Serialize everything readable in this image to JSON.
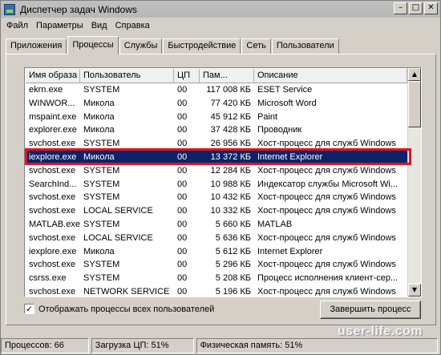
{
  "window": {
    "title": "Диспетчер задач Windows"
  },
  "menu": [
    "Файл",
    "Параметры",
    "Вид",
    "Справка"
  ],
  "tabs": [
    "Приложения",
    "Процессы",
    "Службы",
    "Быстродействие",
    "Сеть",
    "Пользователи"
  ],
  "active_tab": "Процессы",
  "columns": [
    "Имя образа",
    "Пользователь",
    "ЦП",
    "Пам...",
    "Описание"
  ],
  "processes": [
    [
      "ekrn.exe",
      "SYSTEM",
      "00",
      "117 008 КБ",
      "ESET Service"
    ],
    [
      "WINWOR...",
      "Микола",
      "00",
      "77 420 КБ",
      "Microsoft Word"
    ],
    [
      "mspaint.exe",
      "Микола",
      "00",
      "45 912 КБ",
      "Paint"
    ],
    [
      "explorer.exe",
      "Микола",
      "00",
      "37 428 КБ",
      "Проводник"
    ],
    [
      "svchost.exe",
      "SYSTEM",
      "00",
      "26 956 КБ",
      "Хост-процесс для служб Windows"
    ],
    [
      "iexplore.exe",
      "Микола",
      "00",
      "13 372 КБ",
      "Internet Explorer"
    ],
    [
      "svchost.exe",
      "SYSTEM",
      "00",
      "12 284 КБ",
      "Хост-процесс для служб Windows"
    ],
    [
      "SearchInd...",
      "SYSTEM",
      "00",
      "10 988 КБ",
      "Индексатор службы Microsoft Wi..."
    ],
    [
      "svchost.exe",
      "SYSTEM",
      "00",
      "10 432 КБ",
      "Хост-процесс для служб Windows"
    ],
    [
      "svchost.exe",
      "LOCAL SERVICE",
      "00",
      "10 332 КБ",
      "Хост-процесс для служб Windows"
    ],
    [
      "MATLAB.exe",
      "SYSTEM",
      "00",
      "5 660 КБ",
      "MATLAB"
    ],
    [
      "svchost.exe",
      "LOCAL SERVICE",
      "00",
      "5 636 КБ",
      "Хост-процесс для служб Windows"
    ],
    [
      "iexplore.exe",
      "Микола",
      "00",
      "5 612 КБ",
      "Internet Explorer"
    ],
    [
      "svchost.exe",
      "SYSTEM",
      "00",
      "5 296 КБ",
      "Хост-процесс для служб Windows"
    ],
    [
      "csrss.exe",
      "SYSTEM",
      "00",
      "5 208 КБ",
      "Процесс исполнения клиент-сер..."
    ],
    [
      "svchost.exe",
      "NETWORK SERVICE",
      "00",
      "5 196 КБ",
      "Хост-процесс для служб Windows"
    ]
  ],
  "selected_row_index": 5,
  "show_all_users": {
    "label": "Отображать процессы всех пользователей",
    "checked": true
  },
  "end_process_label": "Завершить процесс",
  "status": {
    "processes": "Процессов: 66",
    "cpu": "Загрузка ЦП: 51%",
    "memory": "Физическая память: 51%"
  },
  "watermark": "user-life.com",
  "colors": {
    "selection": "#0a246a",
    "highlight_box": "#e0141e"
  }
}
